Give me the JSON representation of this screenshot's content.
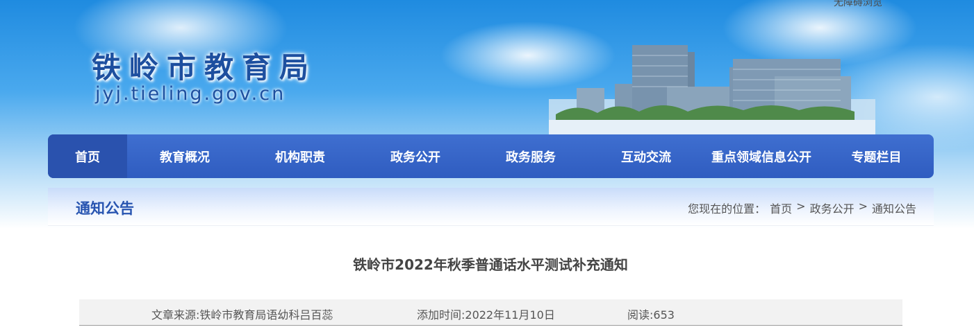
{
  "header": {
    "top_link": "无障碍浏览",
    "site_name": "铁岭市教育局",
    "domain": "jyj.tieling.gov.cn"
  },
  "nav": {
    "items": [
      "首页",
      "教育概况",
      "机构职责",
      "政务公开",
      "政务服务",
      "互动交流",
      "重点领域信息公开",
      "专题栏目"
    ],
    "active_index": 0
  },
  "section": {
    "title": "通知公告",
    "breadcrumb_prefix": "您现在的位置：",
    "breadcrumb": [
      "首页",
      "政务公开",
      "通知公告"
    ],
    "separator": ">"
  },
  "article": {
    "title": "铁岭市2022年秋季普通话水平测试补充通知",
    "source": "文章来源:铁岭市教育局语幼科吕百蕊",
    "date": "添加时间:2022年11月10日",
    "reads": "阅读:653"
  },
  "colors": {
    "nav_bg": "#3162c4",
    "nav_active": "#2a52ae",
    "section_title": "#2754b0"
  }
}
